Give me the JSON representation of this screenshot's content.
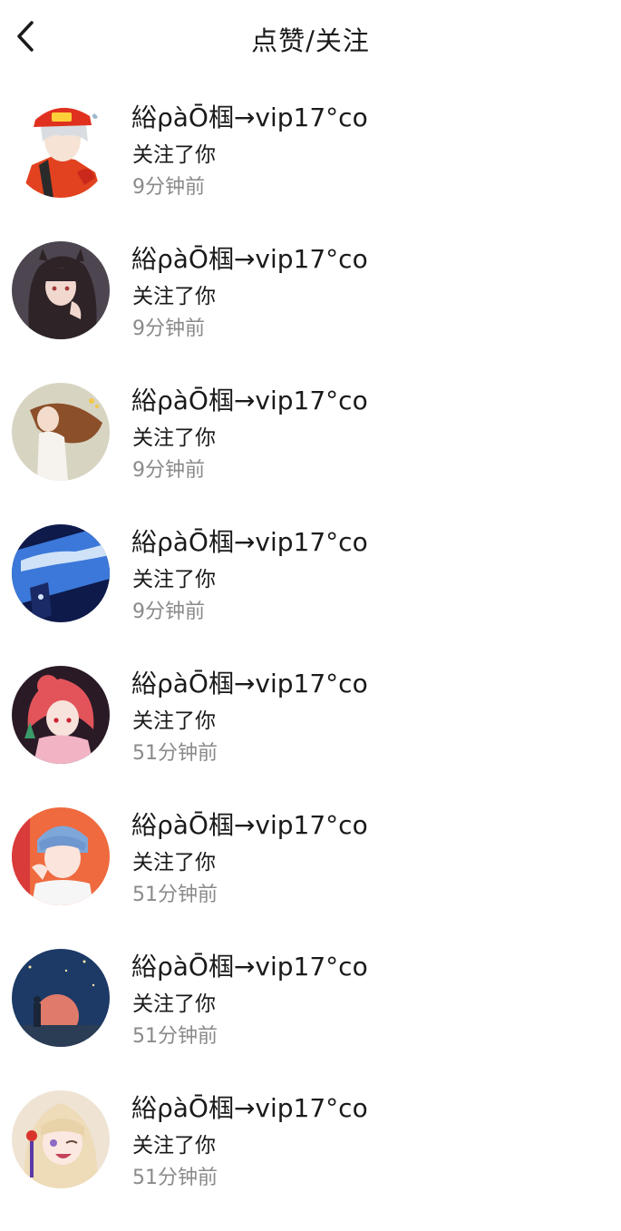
{
  "header": {
    "title": "点赞/关注",
    "back_icon": "chevron-left-icon"
  },
  "notifications": [
    {
      "name": "綌ρàŌ椢→vip17°co",
      "action": "关注了你",
      "time": "9分钟前",
      "avatar": "avatar-firefighter-girl"
    },
    {
      "name": "綌ρàŌ椢→vip17°co",
      "action": "关注了你",
      "time": "9分钟前",
      "avatar": "avatar-dark-hair-girl"
    },
    {
      "name": "綌ρàŌ椢→vip17°co",
      "action": "关注了你",
      "time": "9分钟前",
      "avatar": "avatar-long-hair-girl"
    },
    {
      "name": "綌ρàŌ椢→vip17°co",
      "action": "关注了你",
      "time": "9分钟前",
      "avatar": "avatar-blue-sky"
    },
    {
      "name": "綌ρàŌ椢→vip17°co",
      "action": "关注了你",
      "time": "51分钟前",
      "avatar": "avatar-red-hair-girl"
    },
    {
      "name": "綌ρàŌ椢→vip17°co",
      "action": "关注了你",
      "time": "51分钟前",
      "avatar": "avatar-blue-hair-boy"
    },
    {
      "name": "綌ρàŌ椢→vip17°co",
      "action": "关注了你",
      "time": "51分钟前",
      "avatar": "avatar-night-scene"
    },
    {
      "name": "綌ρàŌ椢→vip17°co",
      "action": "关注了你",
      "time": "51分钟前",
      "avatar": "avatar-blonde-girl"
    }
  ],
  "colors": {
    "text_primary": "#1a1a1a",
    "text_secondary": "#8a8a8a",
    "background": "#ffffff"
  }
}
